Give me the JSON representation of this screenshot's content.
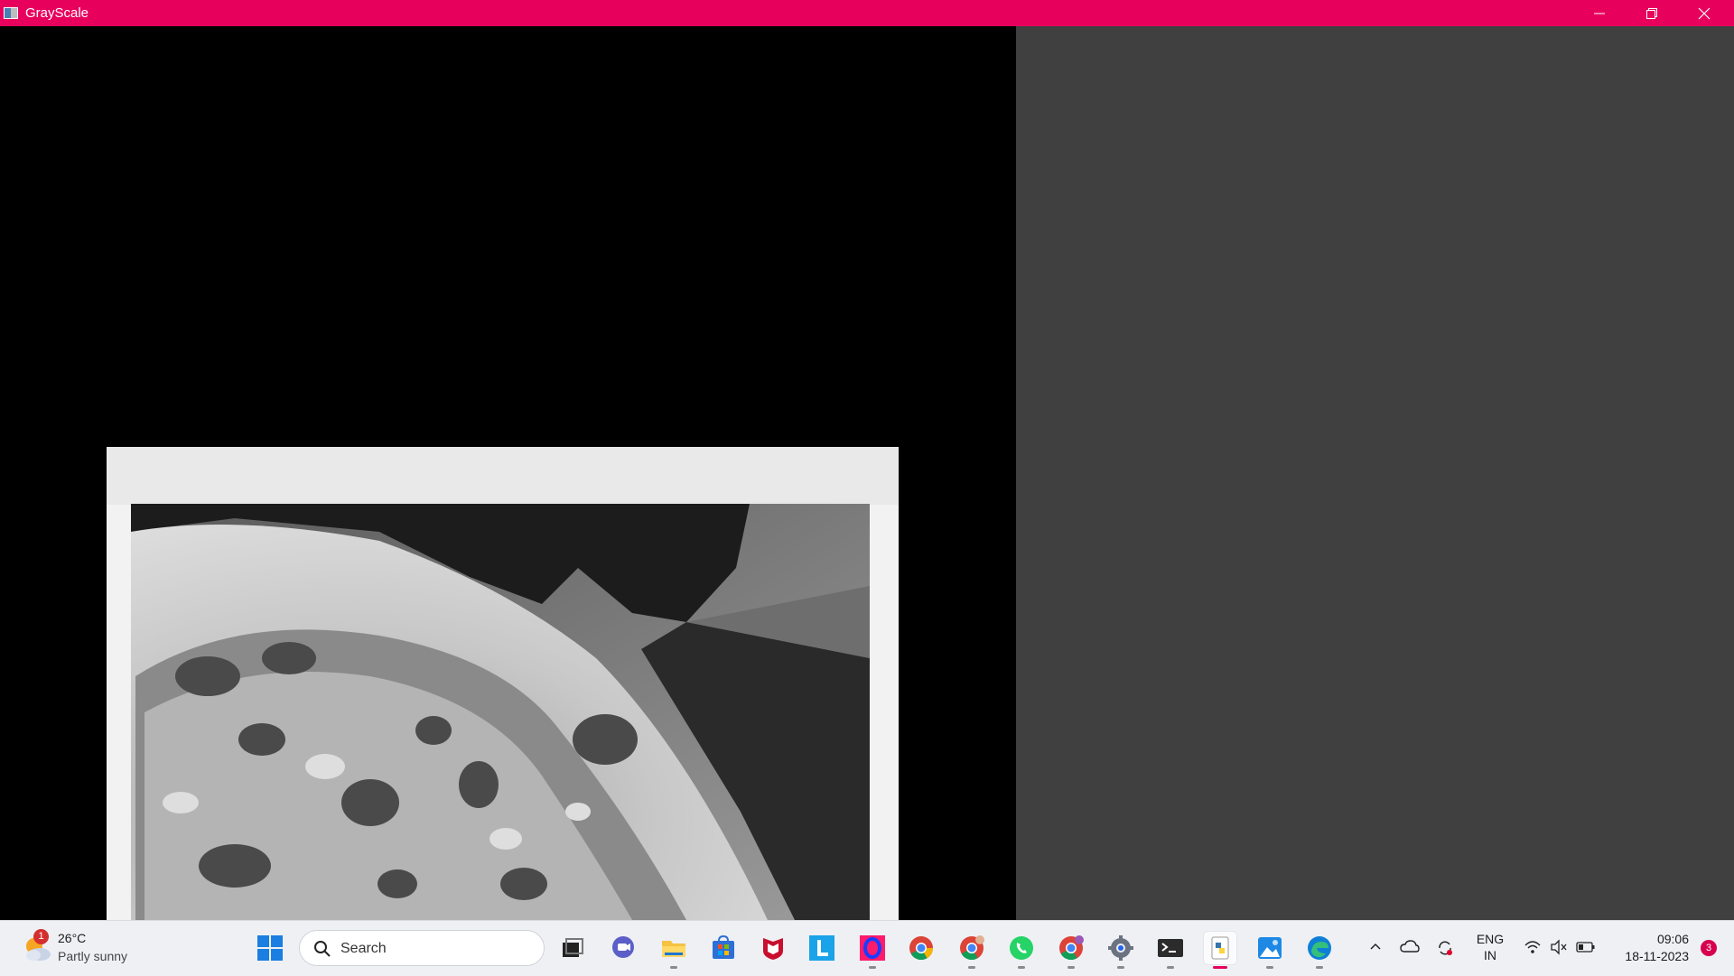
{
  "window": {
    "title": "GrayScale",
    "accent_color": "#e8005d",
    "controls": [
      "minimize-icon",
      "restore-icon",
      "close-icon"
    ]
  },
  "image_view": {
    "mode": "grayscale",
    "right_panel_color": "#404040"
  },
  "taskbar": {
    "weather": {
      "temp": "26°C",
      "desc": "Partly sunny",
      "badge": "1"
    },
    "search": {
      "placeholder": "Search"
    },
    "apps": [
      "windows-start-icon",
      "search-icon",
      "task-view-icon",
      "chat-icon",
      "file-explorer-icon",
      "store-icon",
      "mcafee-icon",
      "l-app-icon",
      "opera-icon",
      "chrome-icon",
      "chrome-profile-icon",
      "whatsapp-icon",
      "chrome-profile-2-icon",
      "settings-icon",
      "terminal-icon",
      "python-icon",
      "photos-icon",
      "edge-icon"
    ],
    "tray": {
      "lang_line1": "ENG",
      "lang_line2": "IN",
      "time": "09:06",
      "date": "18-11-2023",
      "notifications": "3"
    }
  }
}
